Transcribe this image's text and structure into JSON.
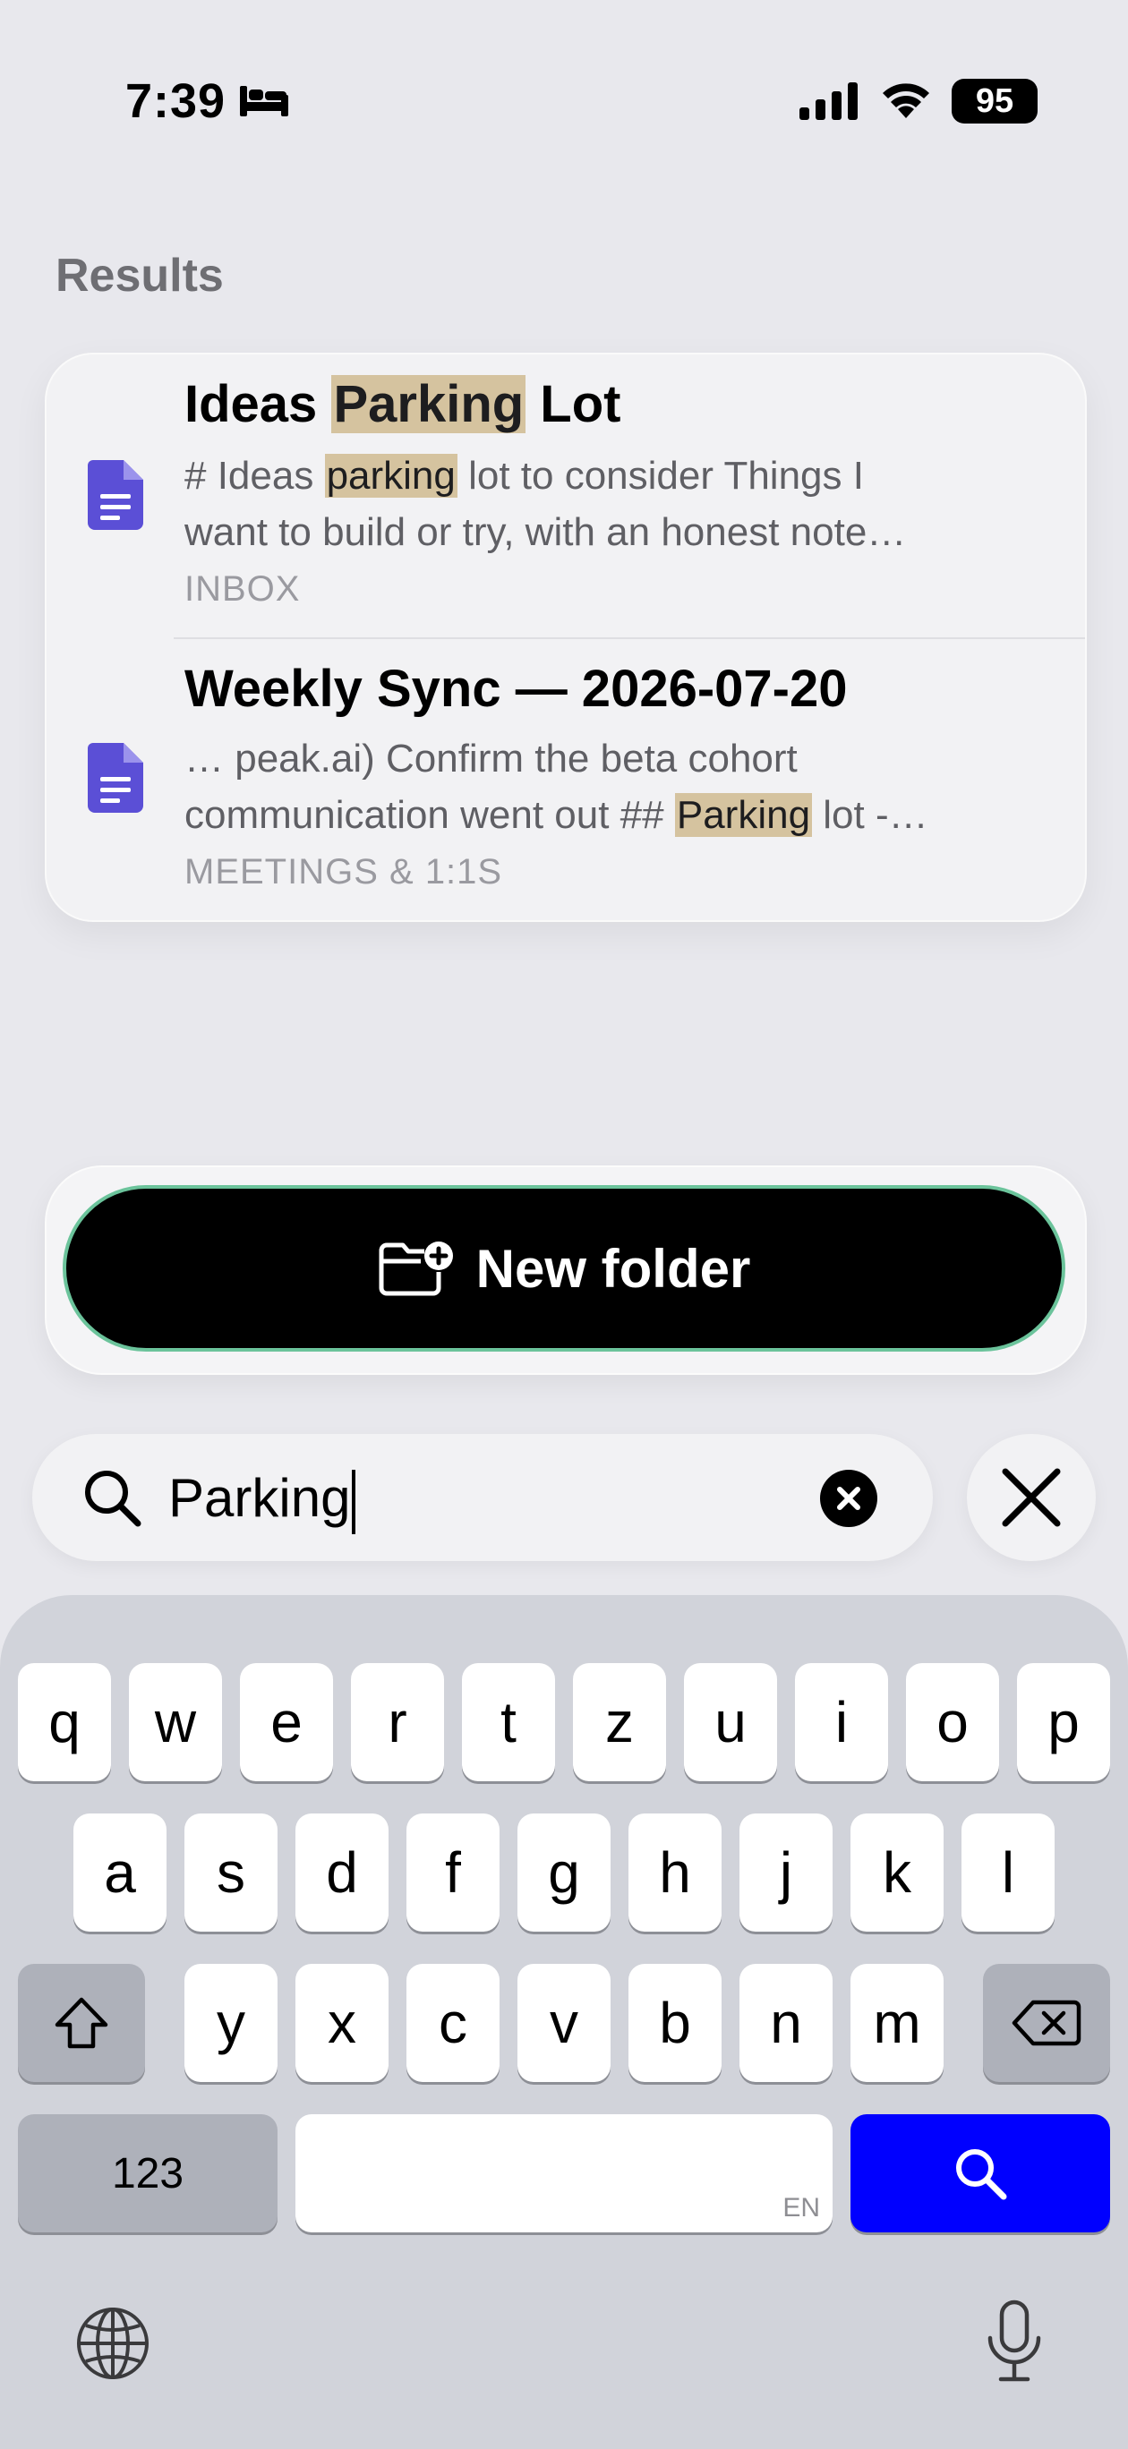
{
  "status_bar": {
    "time": "7:39",
    "battery": "95"
  },
  "results_title": "Results",
  "results": [
    {
      "title_parts": [
        "Ideas ",
        "Parking",
        " Lot"
      ],
      "snippet_line1_parts": [
        "# Ideas ",
        "parking",
        " lot to consider Things I"
      ],
      "snippet_line2": "want to build or try, with an honest note…",
      "folder": "INBOX"
    },
    {
      "title": "Weekly Sync — 2026-07-20",
      "snippet_line1": "… peak.ai) Confirm the beta cohort",
      "snippet_line2_parts": [
        "communication went out ## ",
        "Parking",
        " lot -…"
      ],
      "folder": "MEETINGS & 1:1S"
    }
  ],
  "new_folder_label": "New folder",
  "search": {
    "value": "Parking"
  },
  "keyboard": {
    "row1": [
      "q",
      "w",
      "e",
      "r",
      "t",
      "z",
      "u",
      "i",
      "o",
      "p"
    ],
    "row2": [
      "a",
      "s",
      "d",
      "f",
      "g",
      "h",
      "j",
      "k",
      "l"
    ],
    "row3": [
      "y",
      "x",
      "c",
      "v",
      "b",
      "n",
      "m"
    ],
    "numbers_label": "123",
    "space_lang": "EN"
  },
  "colors": {
    "accent_blue": "#0000ff",
    "doc_icon": "#5b4fd6",
    "highlight": "#d5c39f",
    "button_border": "#6bc39b"
  },
  "icons": [
    "bed-icon",
    "signal-icon",
    "wifi-icon",
    "document-icon",
    "folder-plus-icon",
    "search-icon",
    "clear-icon",
    "close-icon",
    "shift-icon",
    "backspace-icon",
    "globe-icon",
    "microphone-icon"
  ]
}
